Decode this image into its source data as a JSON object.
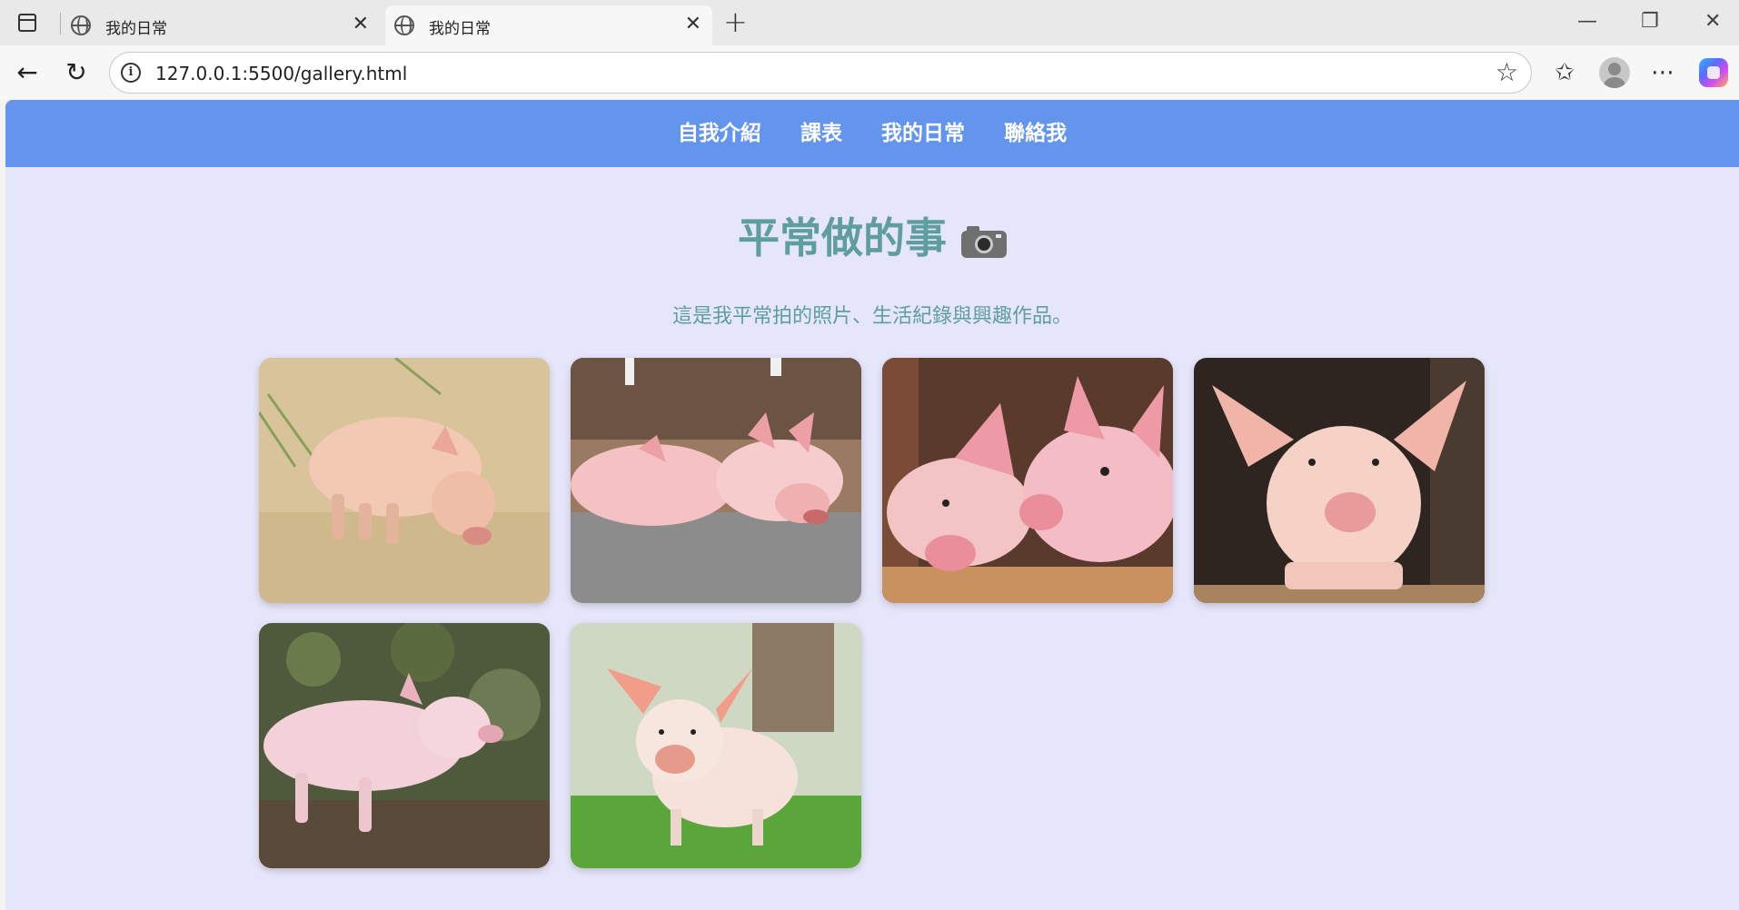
{
  "browser": {
    "tabs": [
      {
        "title": "我的日常",
        "close": "✕"
      },
      {
        "title": "我的日常",
        "close": "✕"
      }
    ],
    "new_tab": "+",
    "window_controls": {
      "minimize": "—",
      "restore": "❐",
      "close": "✕"
    },
    "url": "127.0.0.1:5500/gallery.html",
    "icons": [
      "sidebar-icon",
      "globe-icon",
      "back-icon",
      "refresh-icon",
      "info-icon",
      "star-icon",
      "favorites-icon",
      "profile-icon",
      "more-icon",
      "copilot-icon"
    ],
    "glyphs": {
      "back": "←",
      "refresh": "↻",
      "info": "i",
      "star": "☆",
      "favorites": "✩",
      "more": "⋯"
    }
  },
  "site": {
    "nav": [
      "自我介紹",
      "課表",
      "我的日常",
      "聯絡我"
    ],
    "title": "平常做的事",
    "title_icon": "camera-icon",
    "subtitle": "這是我平常拍的照片、生活紀錄與興趣作品。",
    "photos": [
      {
        "subject": "piglet sniffing sand"
      },
      {
        "subject": "two pigs lying down"
      },
      {
        "subject": "two pigs nuzzling"
      },
      {
        "subject": "pig leaning on fence"
      },
      {
        "subject": "pig beside stone wall"
      },
      {
        "subject": "piglet on grass"
      }
    ]
  },
  "colors": {
    "nav_bg": "#6495ed",
    "page_bg": "#e6e6fa",
    "heading": "#5f9ea0"
  }
}
